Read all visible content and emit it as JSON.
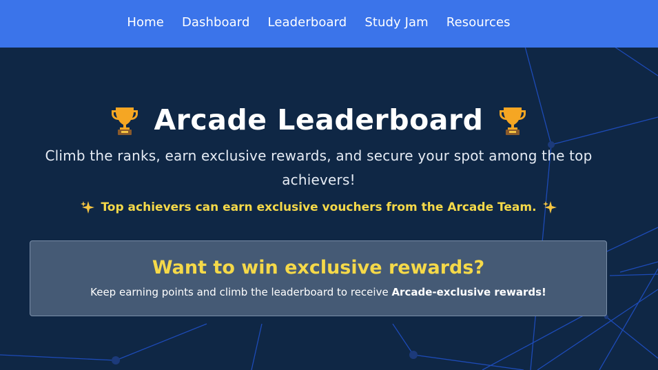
{
  "nav": {
    "items": [
      {
        "label": "Home"
      },
      {
        "label": "Dashboard"
      },
      {
        "label": "Leaderboard"
      },
      {
        "label": "Study Jam"
      },
      {
        "label": "Resources"
      }
    ]
  },
  "hero": {
    "title": "Arcade Leaderboard",
    "left_icon": "trophy-icon",
    "right_icon": "trophy-icon",
    "subtitle": "Climb the ranks, earn exclusive rewards, and secure your spot among the top achievers!",
    "highlight": "Top achievers can earn exclusive vouchers from the Arcade Team.",
    "highlight_icon": "sparkles-icon"
  },
  "reward_card": {
    "title": "Want to win exclusive rewards?",
    "text_prefix": "Keep earning points and climb the leaderboard to receive ",
    "text_bold": "Arcade-exclusive rewards!"
  },
  "colors": {
    "navbar": "#3b74ea",
    "background": "#0f2745",
    "accent_yellow": "#f5d949",
    "card_bg": "#455a75"
  }
}
